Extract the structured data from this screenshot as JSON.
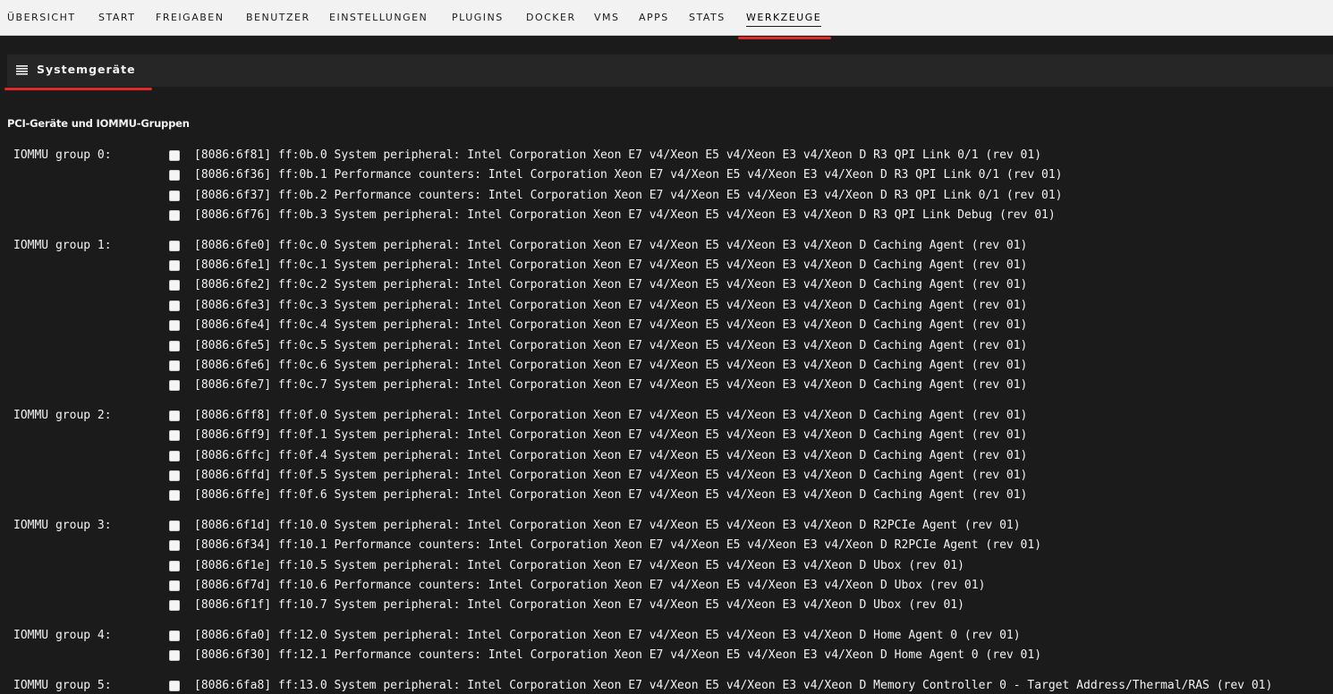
{
  "nav": {
    "tabs": [
      {
        "label": "ÜBERSICHT"
      },
      {
        "label": "START"
      },
      {
        "label": "FREIGABEN"
      },
      {
        "label": "BENUTZER"
      },
      {
        "label": "EINSTELLUNGEN"
      },
      {
        "label": "PLUGINS"
      },
      {
        "label": "DOCKER"
      },
      {
        "label": "VMS"
      },
      {
        "label": "APPS"
      },
      {
        "label": "STATS"
      },
      {
        "label": "WERKZEUGE",
        "active": true
      }
    ]
  },
  "page": {
    "title": "Systemgeräte",
    "title_icon": "list-icon",
    "section_title": "PCI-Geräte und IOMMU-Gruppen"
  },
  "groups": [
    {
      "label": "IOMMU group 0:",
      "devices": [
        "[8086:6f81] ff:0b.0 System peripheral: Intel Corporation Xeon E7 v4/Xeon E5 v4/Xeon E3 v4/Xeon D R3 QPI Link 0/1 (rev 01)",
        "[8086:6f36] ff:0b.1 Performance counters: Intel Corporation Xeon E7 v4/Xeon E5 v4/Xeon E3 v4/Xeon D R3 QPI Link 0/1 (rev 01)",
        "[8086:6f37] ff:0b.2 Performance counters: Intel Corporation Xeon E7 v4/Xeon E5 v4/Xeon E3 v4/Xeon D R3 QPI Link 0/1 (rev 01)",
        "[8086:6f76] ff:0b.3 System peripheral: Intel Corporation Xeon E7 v4/Xeon E5 v4/Xeon E3 v4/Xeon D R3 QPI Link Debug (rev 01)"
      ]
    },
    {
      "label": "IOMMU group 1:",
      "devices": [
        "[8086:6fe0] ff:0c.0 System peripheral: Intel Corporation Xeon E7 v4/Xeon E5 v4/Xeon E3 v4/Xeon D Caching Agent (rev 01)",
        "[8086:6fe1] ff:0c.1 System peripheral: Intel Corporation Xeon E7 v4/Xeon E5 v4/Xeon E3 v4/Xeon D Caching Agent (rev 01)",
        "[8086:6fe2] ff:0c.2 System peripheral: Intel Corporation Xeon E7 v4/Xeon E5 v4/Xeon E3 v4/Xeon D Caching Agent (rev 01)",
        "[8086:6fe3] ff:0c.3 System peripheral: Intel Corporation Xeon E7 v4/Xeon E5 v4/Xeon E3 v4/Xeon D Caching Agent (rev 01)",
        "[8086:6fe4] ff:0c.4 System peripheral: Intel Corporation Xeon E7 v4/Xeon E5 v4/Xeon E3 v4/Xeon D Caching Agent (rev 01)",
        "[8086:6fe5] ff:0c.5 System peripheral: Intel Corporation Xeon E7 v4/Xeon E5 v4/Xeon E3 v4/Xeon D Caching Agent (rev 01)",
        "[8086:6fe6] ff:0c.6 System peripheral: Intel Corporation Xeon E7 v4/Xeon E5 v4/Xeon E3 v4/Xeon D Caching Agent (rev 01)",
        "[8086:6fe7] ff:0c.7 System peripheral: Intel Corporation Xeon E7 v4/Xeon E5 v4/Xeon E3 v4/Xeon D Caching Agent (rev 01)"
      ]
    },
    {
      "label": "IOMMU group 2:",
      "devices": [
        "[8086:6ff8] ff:0f.0 System peripheral: Intel Corporation Xeon E7 v4/Xeon E5 v4/Xeon E3 v4/Xeon D Caching Agent (rev 01)",
        "[8086:6ff9] ff:0f.1 System peripheral: Intel Corporation Xeon E7 v4/Xeon E5 v4/Xeon E3 v4/Xeon D Caching Agent (rev 01)",
        "[8086:6ffc] ff:0f.4 System peripheral: Intel Corporation Xeon E7 v4/Xeon E5 v4/Xeon E3 v4/Xeon D Caching Agent (rev 01)",
        "[8086:6ffd] ff:0f.5 System peripheral: Intel Corporation Xeon E7 v4/Xeon E5 v4/Xeon E3 v4/Xeon D Caching Agent (rev 01)",
        "[8086:6ffe] ff:0f.6 System peripheral: Intel Corporation Xeon E7 v4/Xeon E5 v4/Xeon E3 v4/Xeon D Caching Agent (rev 01)"
      ]
    },
    {
      "label": "IOMMU group 3:",
      "devices": [
        "[8086:6f1d] ff:10.0 System peripheral: Intel Corporation Xeon E7 v4/Xeon E5 v4/Xeon E3 v4/Xeon D R2PCIe Agent (rev 01)",
        "[8086:6f34] ff:10.1 Performance counters: Intel Corporation Xeon E7 v4/Xeon E5 v4/Xeon E3 v4/Xeon D R2PCIe Agent (rev 01)",
        "[8086:6f1e] ff:10.5 System peripheral: Intel Corporation Xeon E7 v4/Xeon E5 v4/Xeon E3 v4/Xeon D Ubox (rev 01)",
        "[8086:6f7d] ff:10.6 Performance counters: Intel Corporation Xeon E7 v4/Xeon E5 v4/Xeon E3 v4/Xeon D Ubox (rev 01)",
        "[8086:6f1f] ff:10.7 System peripheral: Intel Corporation Xeon E7 v4/Xeon E5 v4/Xeon E3 v4/Xeon D Ubox (rev 01)"
      ]
    },
    {
      "label": "IOMMU group 4:",
      "devices": [
        "[8086:6fa0] ff:12.0 System peripheral: Intel Corporation Xeon E7 v4/Xeon E5 v4/Xeon E3 v4/Xeon D Home Agent 0 (rev 01)",
        "[8086:6f30] ff:12.1 Performance counters: Intel Corporation Xeon E7 v4/Xeon E5 v4/Xeon E3 v4/Xeon D Home Agent 0 (rev 01)"
      ]
    },
    {
      "label": "IOMMU group 5:",
      "devices": [
        "[8086:6fa8] ff:13.0 System peripheral: Intel Corporation Xeon E7 v4/Xeon E5 v4/Xeon E3 v4/Xeon D Memory Controller 0 - Target Address/Thermal/RAS (rev 01)"
      ]
    }
  ]
}
